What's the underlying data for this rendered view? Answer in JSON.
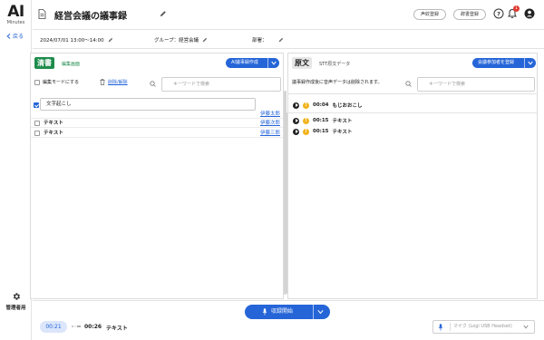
{
  "sidebar": {
    "logo": "AI",
    "logo_sub": "Minutes",
    "back_label": "戻る",
    "admin_label": "管理者用"
  },
  "header": {
    "title": "経営会議の議事録",
    "voice_btn": "声紋登録",
    "dict_btn": "辞書登録",
    "notification_count": "1"
  },
  "meta": {
    "datetime": "2024/07/01 13:00～14:00",
    "group": "グループ：経営会議",
    "location": "部署："
  },
  "left_panel": {
    "tag": "清書",
    "tag_sub": "編集画面",
    "ai_button": "AI議事録作成",
    "edit_mode_label": "編集モードにする",
    "delete_label": "削除/解除",
    "search_placeholder": "キーワードで検索",
    "edit_value": "文字起こし",
    "rows": [
      {
        "text": "",
        "speaker": "伊藤太郎"
      },
      {
        "text": "テキスト",
        "speaker": "伊藤次郎"
      },
      {
        "text": "テキスト",
        "speaker": "伊藤三郎"
      }
    ]
  },
  "right_panel": {
    "tag": "原文",
    "tag_sub": "STT原文データ",
    "minutes_button": "会議参加者を登録",
    "notice": "議事録作成後に音声データは削除されます。",
    "search_placeholder": "キーワードで検索",
    "entries": [
      {
        "time": "00:04",
        "text": "もじおおこし"
      },
      {
        "time": "00:15",
        "text": "テキスト"
      },
      {
        "time": "00:15",
        "text": "テキスト"
      }
    ]
  },
  "bottom": {
    "record_label": "収録開始",
    "current_time": "00:21",
    "next_time": "00:26",
    "next_text": "テキスト",
    "mic_option": "マイク (Logi USB Headset)"
  },
  "colors": {
    "accent": "#2565d8",
    "green": "#1e8c4c",
    "warning": "#f2b21b",
    "alert": "#e03a2f"
  }
}
